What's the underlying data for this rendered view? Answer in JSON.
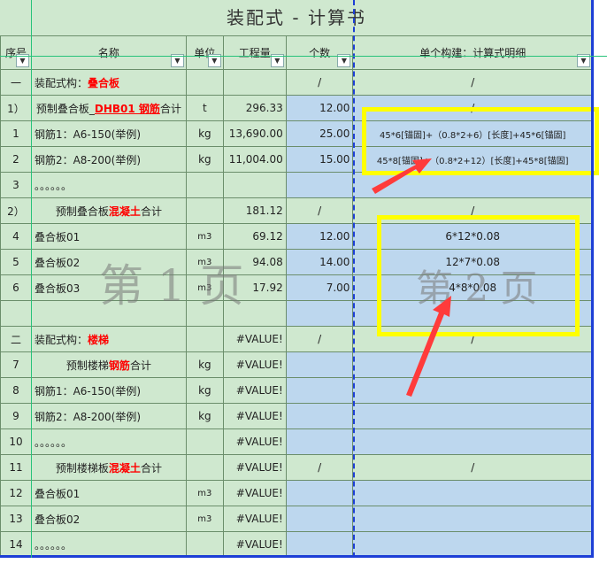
{
  "sheet_title": "装配式 - 计算书",
  "headers": {
    "seq": "序号",
    "name": "名称",
    "unit": "单位",
    "quantity": "工程量",
    "count": "个数",
    "detail": "单个构建：计算式明细"
  },
  "rows": [
    {
      "seq": "一",
      "name": "装配式构：",
      "name_red": "叠合板",
      "unit": "",
      "qty": "",
      "count": "/",
      "detail": "/"
    },
    {
      "seq": "1）",
      "name": "预制叠合板_",
      "name_redu": "DHB01 钢筋",
      "name_tail": "合计",
      "unit": "t",
      "qty": "296.33",
      "count": "12.00",
      "detail": "/"
    },
    {
      "seq": "1",
      "name": "钢筋1：A6-150(举例)",
      "unit": "kg",
      "qty": "13,690.00",
      "count": "25.00",
      "detail": "45*6[锚固]+（0.8*2+6）[长度]+45*6[锚固]"
    },
    {
      "seq": "2",
      "name": "钢筋2：A8-200(举例)",
      "unit": "kg",
      "qty": "11,004.00",
      "count": "15.00",
      "detail": "45*8[锚固]+（0.8*2+12）[长度]+45*8[锚固]"
    },
    {
      "seq": "3",
      "name": "。。。。。。",
      "unit": "",
      "qty": "",
      "count": "",
      "detail": ""
    },
    {
      "seq": "2）",
      "name": "预制叠合板",
      "name_red": "混凝土",
      "name_tail": "合计",
      "unit": "",
      "qty": "181.12",
      "count": "/",
      "detail": "/"
    },
    {
      "seq": "4",
      "name": "叠合板01",
      "unit": "m3",
      "qty": "69.12",
      "count": "12.00",
      "detail": "6*12*0.08"
    },
    {
      "seq": "5",
      "name": "叠合板02",
      "unit": "m3",
      "qty": "94.08",
      "count": "14.00",
      "detail": "12*7*0.08"
    },
    {
      "seq": "6",
      "name": "叠合板03",
      "unit": "m3",
      "qty": "17.92",
      "count": "7.00",
      "detail": "4*8*0.08"
    },
    {
      "seq": "",
      "name": "",
      "unit": "",
      "qty": "",
      "count": "",
      "detail": ""
    },
    {
      "seq": "二",
      "name": "装配式构：",
      "name_red": "楼梯",
      "unit": "",
      "qty": "#VALUE!",
      "count": "/",
      "detail": "/"
    },
    {
      "seq": "7",
      "name": "预制楼梯",
      "name_red": "钢筋",
      "name_tail": "合计",
      "unit": "kg",
      "qty": "#VALUE!",
      "count": "",
      "detail": ""
    },
    {
      "seq": "8",
      "name": "钢筋1：A6-150(举例)",
      "unit": "kg",
      "qty": "#VALUE!",
      "count": "",
      "detail": ""
    },
    {
      "seq": "9",
      "name": "钢筋2：A8-200(举例)",
      "unit": "kg",
      "qty": "#VALUE!",
      "count": "",
      "detail": ""
    },
    {
      "seq": "10",
      "name": "。。。。。。",
      "unit": "",
      "qty": "#VALUE!",
      "count": "",
      "detail": ""
    },
    {
      "seq": "11",
      "name": "预制楼梯板",
      "name_red": "混凝土",
      "name_tail": "合计",
      "unit": "",
      "qty": "#VALUE!",
      "count": "/",
      "detail": "/"
    },
    {
      "seq": "12",
      "name": "叠合板01",
      "unit": "m3",
      "qty": "#VALUE!",
      "count": "",
      "detail": ""
    },
    {
      "seq": "13",
      "name": "叠合板02",
      "unit": "m3",
      "qty": "#VALUE!",
      "count": "",
      "detail": ""
    },
    {
      "seq": "14",
      "name": "。。。。。。",
      "unit": "",
      "qty": "#VALUE!",
      "count": "",
      "detail": ""
    }
  ],
  "watermarks": {
    "page1": "第 1 页",
    "page2": "第 2 页"
  },
  "colors": {
    "cell_green": "#cfe8cf",
    "cell_blue": "#bdd7ee",
    "highlight": "#ffff00",
    "arrow": "#ff3b3b",
    "page_break": "#1d3fd6",
    "red_text": "#ff0000"
  }
}
